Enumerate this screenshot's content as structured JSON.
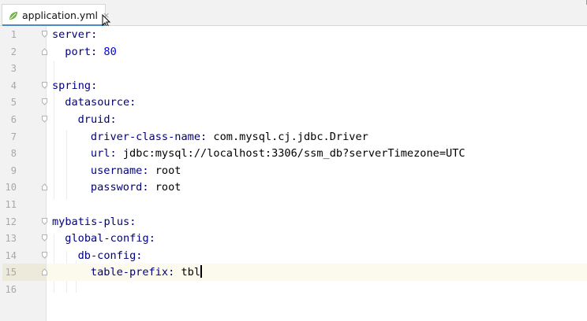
{
  "tab": {
    "filename": "application.yml",
    "close_glyph": "×",
    "icon": "spring-leaf-icon",
    "underline_color": "#4a88c7"
  },
  "editor": {
    "current_line": 15,
    "lines": [
      {
        "num": "1",
        "key": "server:",
        "value": ""
      },
      {
        "num": "2",
        "key": "port:",
        "value": "80"
      },
      {
        "num": "3",
        "key": "",
        "value": ""
      },
      {
        "num": "4",
        "key": "spring:",
        "value": ""
      },
      {
        "num": "5",
        "key": "datasource:",
        "value": ""
      },
      {
        "num": "6",
        "key": "druid:",
        "value": ""
      },
      {
        "num": "7",
        "key": "driver-class-name:",
        "value": "com.mysql.cj.jdbc.Driver"
      },
      {
        "num": "8",
        "key": "url:",
        "value": "jdbc:mysql://localhost:3306/ssm_db?serverTimezone=UTC"
      },
      {
        "num": "9",
        "key": "username:",
        "value": "root"
      },
      {
        "num": "10",
        "key": "password:",
        "value": "root"
      },
      {
        "num": "11",
        "key": "",
        "value": ""
      },
      {
        "num": "12",
        "key": "mybatis-plus:",
        "value": ""
      },
      {
        "num": "13",
        "key": "global-config:",
        "value": ""
      },
      {
        "num": "14",
        "key": "db-config:",
        "value": ""
      },
      {
        "num": "15",
        "key": "table-prefix:",
        "value": "tbl"
      },
      {
        "num": "16",
        "key": "",
        "value": ""
      }
    ]
  },
  "colors": {
    "key": "#000080",
    "number": "#0000ff",
    "current_line_bg": "#fcfaed"
  }
}
